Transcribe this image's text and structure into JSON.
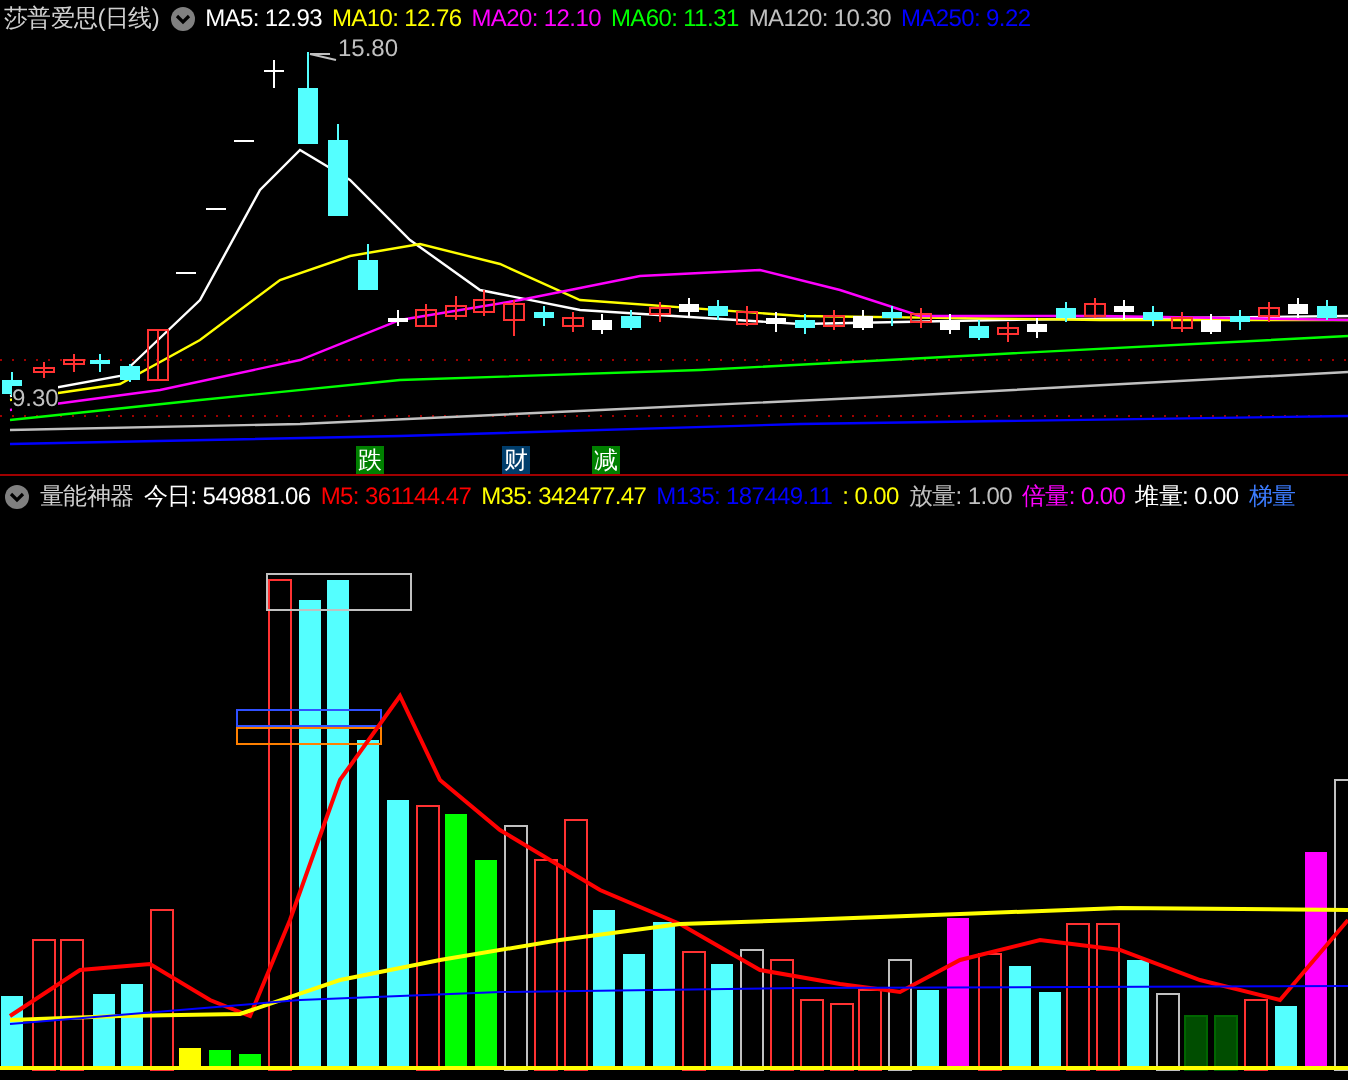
{
  "main_chart": {
    "title": "莎普爱思(日线)",
    "indicators": [
      {
        "label": "MA5: 12.93",
        "color": "#ffffff"
      },
      {
        "label": "MA10: 12.76",
        "color": "#ffff00"
      },
      {
        "label": "MA20: 12.10",
        "color": "#ff00ff"
      },
      {
        "label": "MA60: 11.31",
        "color": "#00ff00"
      },
      {
        "label": "MA120: 10.30",
        "color": "#c0c0c0"
      },
      {
        "label": "MA250: 9.22",
        "color": "#0000ff"
      }
    ],
    "high_label": "15.80",
    "low_label": "9.30",
    "signals": [
      {
        "label": "跌",
        "color": "#008000"
      },
      {
        "label": "财",
        "color": "#003d6b"
      },
      {
        "label": "减",
        "color": "#008000"
      }
    ]
  },
  "volume_panel": {
    "title": "量能神器",
    "indicators": [
      {
        "label": "今日: 549881.06",
        "color": "#ffffff"
      },
      {
        "label": "M5: 361144.47",
        "color": "#ff0000"
      },
      {
        "label": "M35: 342477.47",
        "color": "#ffff00"
      },
      {
        "label": "M135: 187449.11",
        "color": "#0000ff"
      },
      {
        "label": ": 0.00",
        "color": "#ffff00"
      },
      {
        "label": "放量: 1.00",
        "color": "#c0c0c0"
      },
      {
        "label": "倍量: 0.00",
        "color": "#ff00ff"
      },
      {
        "label": "堆量: 0.00",
        "color": "#ffffff"
      },
      {
        "label": "梯量",
        "color": "#3c7cff"
      }
    ]
  }
}
